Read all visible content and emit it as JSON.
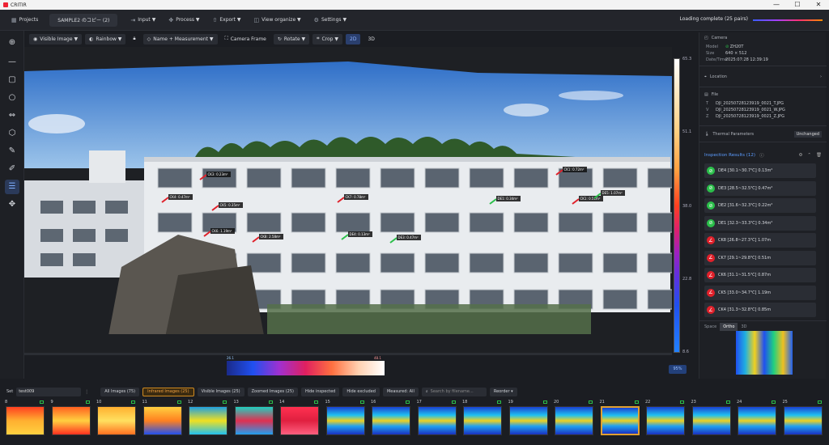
{
  "app": {
    "title": "CRITIR",
    "window_controls": [
      "—",
      "☐",
      "✕"
    ]
  },
  "menu": {
    "projects": "Projects",
    "tab": "SAMPLE2 のコピー (2)",
    "items": [
      "Input ▼",
      "Process ▼",
      "Export ▼",
      "View organize ▼",
      "Settings ▼"
    ],
    "status": "Loading complete (25 pairs)"
  },
  "viewbar": {
    "visible_image": "Visible Image ▼",
    "palette": "Rainbow ▼",
    "labels": "Name + Measurement ▼",
    "camera_frame": "Camera Frame",
    "rotate": "Rotate ▼",
    "crop": "Crop ▼",
    "mode_2d": "2D",
    "mode_3d": "3D"
  },
  "colorbar": {
    "max": "65.3",
    "t1": "51.1",
    "t2": "38.0",
    "t3": "22.8",
    "min": "8.6",
    "zoom": "95%"
  },
  "histogram": {
    "low": "26.1",
    "high": "48.1"
  },
  "labels_on_image": [
    "CK3: 0.23m²",
    "CK4: 0.47m²",
    "CK5: 0.35m²",
    "CK7: 0.78m²",
    "DE1: 0.34m²",
    "CK1: 0.51m²",
    "CK6: 1.19m²",
    "CK8: 2.58m²",
    "DE4: 0.13m²",
    "DE3: 0.47m²",
    "CK1: 0.72m²",
    "DE5: 1.07m²"
  ],
  "right_panel": {
    "camera_header": "Camera",
    "camera": [
      {
        "k": "Model",
        "v": "ZH20T"
      },
      {
        "k": "Size",
        "v": "640 × 512"
      },
      {
        "k": "Date/Time",
        "v": "2025:07:28 12:39:19"
      }
    ],
    "location_header": "Location",
    "file_header": "File",
    "files": [
      {
        "k": "T",
        "v": "DJI_20250728123919_0021_T.JPG"
      },
      {
        "k": "V",
        "v": "DJI_20250728123919_0021_W.JPG"
      },
      {
        "k": "Z",
        "v": "DJI_20250728123919_0021_Z.JPG"
      }
    ],
    "thermal_header": "Thermal Parameters",
    "thermal_badge": "Unchanged",
    "inspection_title": "Inspection Results (12)",
    "results": [
      {
        "kind": "g",
        "text": "DE4  [30.1~30.7℃]  0.13m²"
      },
      {
        "kind": "g",
        "text": "DE3  [28.5~32.5℃]  0.47m²"
      },
      {
        "kind": "g",
        "text": "DE2  [31.6~32.3℃]  0.22m²"
      },
      {
        "kind": "g",
        "text": "DE1  [32.3~33.3℃]  0.34m²"
      },
      {
        "kind": "r",
        "text": "CK8  [26.8~27.3℃]  1.07m"
      },
      {
        "kind": "r",
        "text": "CK7  [29.1~29.8℃]  0.51m"
      },
      {
        "kind": "r",
        "text": "CK6  [31.1~31.5℃]  0.87m"
      },
      {
        "kind": "r",
        "text": "CK5  [33.0~34.7℃]  1.19m"
      },
      {
        "kind": "r",
        "text": "CK4  [31.3~32.8℃]  0.85m"
      }
    ],
    "minimap_tabs": [
      "Space",
      "Ortho",
      "3D"
    ]
  },
  "filmbar": {
    "set_label": "Set",
    "set_value": "test009",
    "buttons": [
      "All Images (75)",
      "Infrared Images (25)",
      "Visible Images (25)",
      "Zoomed Images (25)",
      "Hide inspected",
      "Hide excluded",
      "Measured: All"
    ],
    "search_placeholder": "Search by filename...",
    "reorder": "Reorder ▾"
  },
  "thumbnails": [
    "8",
    "9",
    "10",
    "11",
    "12",
    "13",
    "14",
    "15",
    "16",
    "17",
    "18",
    "19",
    "20",
    "21",
    "22",
    "23",
    "24",
    "25"
  ],
  "selected_thumb": "21"
}
